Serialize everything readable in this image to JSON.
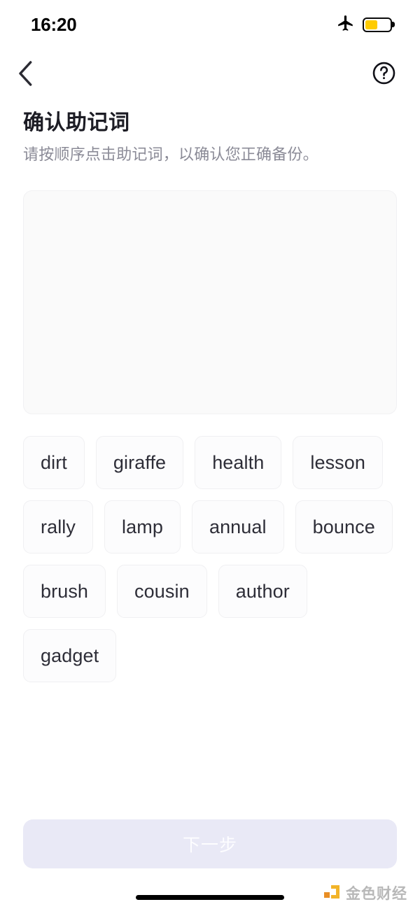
{
  "status_bar": {
    "time": "16:20",
    "airplane_icon": "airplane-mode-icon",
    "battery_icon": "battery-low-power-icon",
    "battery_level_percent": 50,
    "battery_fill_color": "#FFCC00"
  },
  "nav_bar": {
    "back_icon": "chevron-left-icon",
    "help_icon": "question-mark-circle-icon"
  },
  "heading": {
    "title": "确认助记词",
    "subtitle": "请按顺序点击助记词，以确认您正确备份。"
  },
  "answer_area": {
    "selected_words": [],
    "empty": true
  },
  "word_pool": {
    "words": [
      "dirt",
      "giraffe",
      "health",
      "lesson",
      "rally",
      "lamp",
      "annual",
      "bounce",
      "brush",
      "cousin",
      "author",
      "gadget"
    ]
  },
  "footer": {
    "next_label": "下一步",
    "next_disabled": true,
    "next_bg_color": "#E9E9F6",
    "next_text_color": "#FDFDFF"
  },
  "watermark": {
    "text": "金色财经",
    "logo_icon": "jinse-finance-logo-icon",
    "logo_color_primary": "#F2B01E",
    "logo_color_secondary": "#E8891A"
  },
  "home_indicator": {
    "label": "home-indicator"
  }
}
